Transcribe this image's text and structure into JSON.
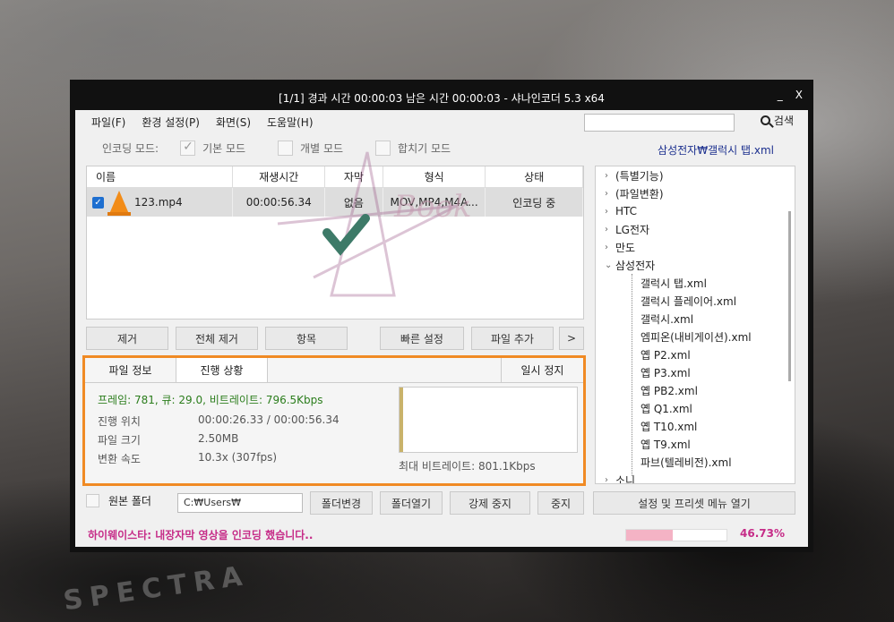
{
  "background": {
    "label": "SPECTRA"
  },
  "titlebar": {
    "title": "[1/1] 경과 시간 00:00:03  남은 시간 00:00:03 - 샤나인코더 5.3 x64",
    "minimize": "_",
    "close": "X"
  },
  "menu": {
    "items": [
      "파일(F)",
      "환경 설정(P)",
      "화면(S)",
      "도움말(H)"
    ],
    "search_label": "검색",
    "search_value": ""
  },
  "modes": {
    "label": "인코딩 모드:",
    "basic": "기본 모드",
    "individual": "개별 모드",
    "merge": "합치기 모드",
    "basic_checked": true
  },
  "preset_file": "삼성전자₩갤럭시 탭.xml",
  "file_list": {
    "columns": [
      "이름",
      "재생시간",
      "자막",
      "형식",
      "상태"
    ],
    "rows": [
      {
        "name": "123.mp4",
        "duration": "00:00:56.34",
        "subtitle": "없음",
        "format": "MOV,MP4,M4A...",
        "status": "인코딩 중",
        "checked": true
      }
    ]
  },
  "list_buttons": {
    "remove": "제거",
    "remove_all": "전체 제거",
    "item": "항목",
    "quick_settings": "빠른 설정",
    "add_file": "파일 추가",
    "more": ">"
  },
  "panel": {
    "tab_file_info": "파일 정보",
    "tab_progress": "진행 상황",
    "pause": "일시 정지",
    "frame_line": "프레임: 781, 큐: 29.0, 비트레이트: 796.5Kbps",
    "position_label": "진행 위치",
    "position_value": "00:00:26.33 / 00:00:56.34",
    "size_label": "파일 크기",
    "size_value": "2.50MB",
    "speed_label": "변환 속도",
    "speed_value": "10.3x (307fps)",
    "max_bitrate": "최대 비트레이트: 801.1Kbps"
  },
  "tree": {
    "top_items": [
      "(특별기능)",
      "(파일변환)",
      "HTC",
      "LG전자",
      "만도",
      "삼성전자"
    ],
    "children": [
      "갤럭시 탭.xml",
      "갤럭시 플레이어.xml",
      "갤럭시.xml",
      "엠피온(내비게이션).xml",
      "옙 P2.xml",
      "옙 P3.xml",
      "옙 PB2.xml",
      "옙 Q1.xml",
      "옙 T10.xml",
      "옙 T9.xml",
      "파브(텔레비전).xml"
    ],
    "last_item": "소니"
  },
  "bottom": {
    "source_folder": "원본 폴더",
    "path": "C:₩Users₩",
    "change_folder": "폴더변경",
    "open_folder": "폴더열기",
    "force_stop": "강제 중지",
    "stop": "중지",
    "settings_menu": "설정 및 프리셋 메뉴 열기"
  },
  "status": {
    "message": "하이웨이스타: 내장자막 영상을 인코딩 했습니다..",
    "progress": 0.4673,
    "percent_text": "46.73%"
  },
  "colors": {
    "highlight_border": "#f08a24",
    "status_text": "#c62c88",
    "frame_text": "#2b7d1c",
    "preset_text": "#1b2f8e",
    "progress_fill": "#f4b3c5"
  },
  "watermark": {
    "text": "Book"
  }
}
